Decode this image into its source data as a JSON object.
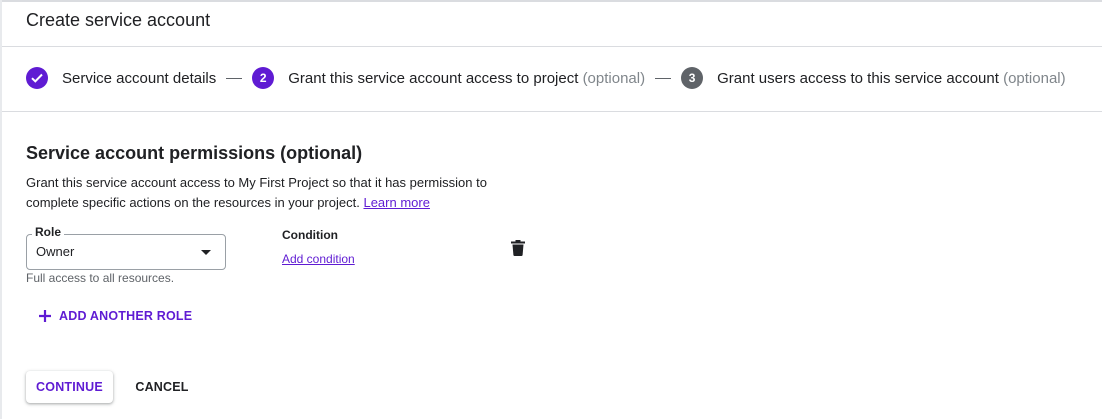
{
  "header": {
    "title": "Create service account"
  },
  "stepper": {
    "steps": [
      {
        "number": "",
        "label": "Service account details",
        "optional": "",
        "state": "completed"
      },
      {
        "number": "2",
        "label": "Grant this service account access to project",
        "optional": "(optional)",
        "state": "active"
      },
      {
        "number": "3",
        "label": "Grant users access to this service account",
        "optional": "(optional)",
        "state": "inactive"
      }
    ]
  },
  "permissions": {
    "title": "Service account permissions (optional)",
    "description": "Grant this service account access to My First Project so that it has permission to complete specific actions on the resources in your project.",
    "learn_more": "Learn more",
    "role": {
      "label": "Role",
      "value": "Owner",
      "hint": "Full access to all resources."
    },
    "condition": {
      "label": "Condition",
      "add_link": "Add condition"
    },
    "add_role_label": "ADD ANOTHER ROLE"
  },
  "actions": {
    "continue_label": "CONTINUE",
    "cancel_label": "CANCEL"
  },
  "colors": {
    "accent": "#5f1bd3",
    "step_inactive": "#5f6368",
    "muted_text": "#80868b"
  },
  "icons": {
    "step1": "check-circle-icon",
    "dropdown": "chevron-down-icon",
    "delete": "trash-icon",
    "add": "plus-icon"
  }
}
